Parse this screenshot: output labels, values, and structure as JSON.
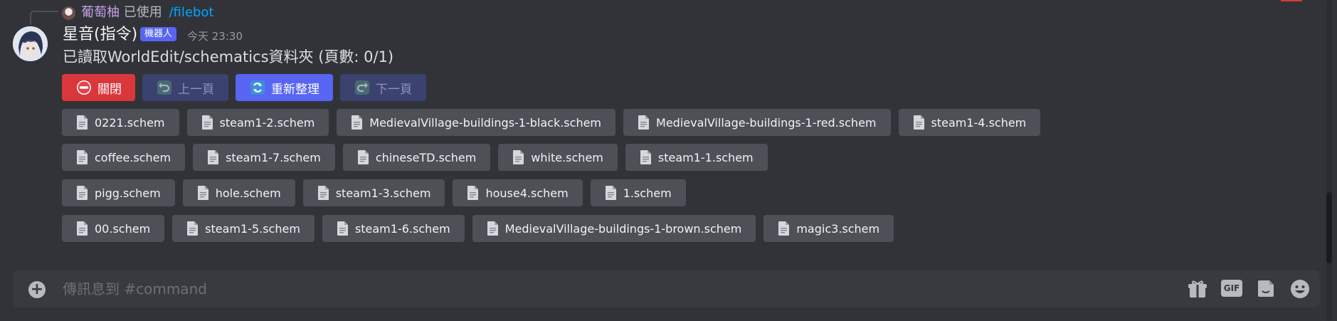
{
  "reply": {
    "username": "葡萄柚",
    "used_text": "已使用",
    "command": "/filebot"
  },
  "message": {
    "author": "星音(指令)",
    "bot_tag": "機器人",
    "timestamp": "今天 23:30",
    "content": "已讀取WorldEdit/schematics資料夾 (頁數: 0/1)"
  },
  "buttons": {
    "close": "關閉",
    "prev": "上一頁",
    "refresh": "重新整理",
    "next": "下一頁"
  },
  "file_rows": [
    [
      "0221.schem",
      "steam1-2.schem",
      "MedievalVillage-buildings-1-black.schem",
      "MedievalVillage-buildings-1-red.schem",
      "steam1-4.schem"
    ],
    [
      "coffee.schem",
      "steam1-7.schem",
      "chineseTD.schem",
      "white.schem",
      "steam1-1.schem"
    ],
    [
      "pigg.schem",
      "hole.schem",
      "steam1-3.schem",
      "house4.schem",
      "1.schem"
    ],
    [
      "00.schem",
      "steam1-5.schem",
      "steam1-6.schem",
      "MedievalVillage-buildings-1-brown.schem",
      "magic3.schem"
    ]
  ],
  "input": {
    "placeholder": "傳訊息到 #command",
    "gif_label": "GIF"
  },
  "icons": {
    "close": "no-entry-icon",
    "prev": "undo-arrow-icon",
    "refresh": "refresh-icon",
    "next": "redo-arrow-icon",
    "file": "file-icon",
    "attach": "plus-circle-icon",
    "gift": "gift-icon",
    "gif": "gif-icon",
    "sticker": "sticker-icon",
    "emoji": "emoji-icon"
  },
  "colors": {
    "background": "#313338",
    "blurple": "#5865f2",
    "danger": "#da373c",
    "chip": "#4e5058",
    "link": "#00a8fc"
  }
}
